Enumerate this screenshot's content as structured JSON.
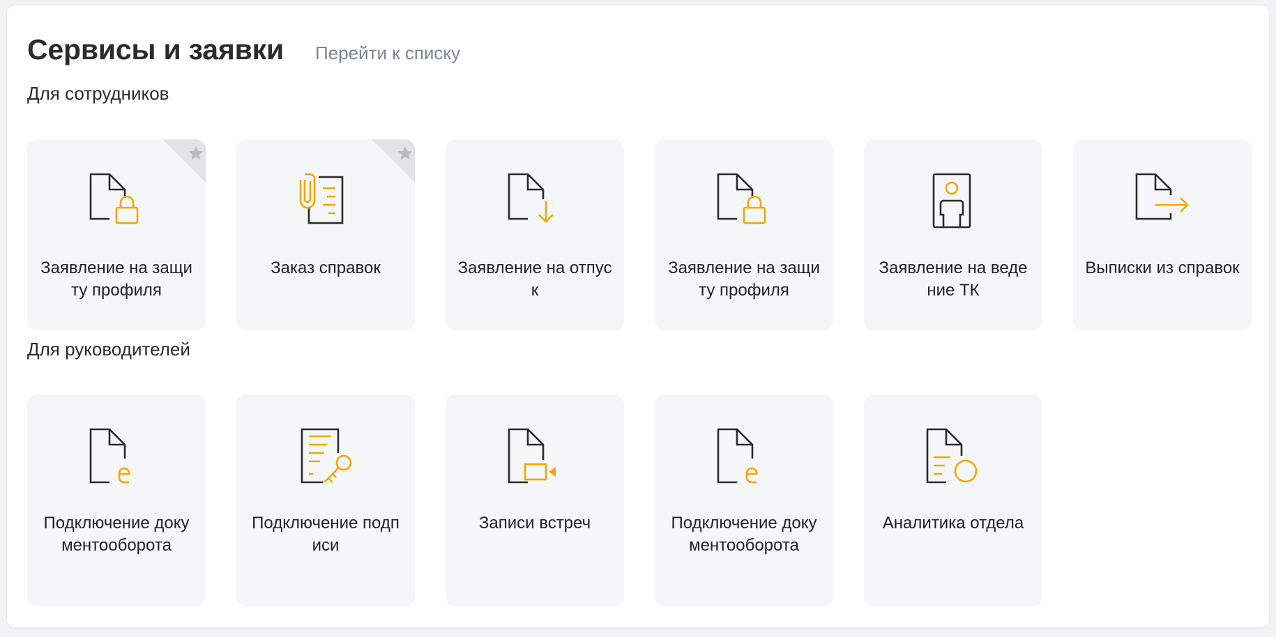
{
  "header": {
    "title": "Сервисы и заявки",
    "link": "Перейти к списку"
  },
  "sections": [
    {
      "title": "Для сотрудников",
      "cards": [
        {
          "label": "Заявление на защиту профиля",
          "icon": "document-lock-icon",
          "favorite": true
        },
        {
          "label": "Заказ справок",
          "icon": "document-clip-icon",
          "favorite": true
        },
        {
          "label": "Заявление на отпуск",
          "icon": "document-download-icon",
          "favorite": false
        },
        {
          "label": "Заявление на защиту профиля",
          "icon": "document-lock-icon",
          "favorite": false
        },
        {
          "label": "Заявление на ведение ТК",
          "icon": "document-person-icon",
          "favorite": false
        },
        {
          "label": "Выписки из справок",
          "icon": "document-arrow-icon",
          "favorite": false
        }
      ]
    },
    {
      "title": "Для руководителей",
      "cards": [
        {
          "label": "Подключение документооборота",
          "icon": "document-e-icon"
        },
        {
          "label": "Подключение подписи",
          "icon": "document-key-icon"
        },
        {
          "label": "Записи встреч",
          "icon": "document-video-icon"
        },
        {
          "label": "Подключение документооборота",
          "icon": "document-e-icon"
        },
        {
          "label": "Аналитика отдела",
          "icon": "document-circle-icon"
        }
      ]
    }
  ],
  "colors": {
    "accent": "#f5a600",
    "icon_dark": "#2a2a2a",
    "card_bg": "#f5f6f7",
    "fav_corner": "#e2e3e5",
    "fav_star": "#b9bbbf"
  }
}
